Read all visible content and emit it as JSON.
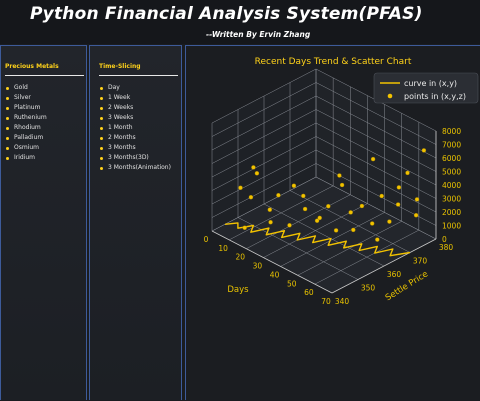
{
  "app": {
    "title": "Python Financial Analysis System(PFAS)",
    "subtitle": "--Written By Ervin Zhang"
  },
  "metals_panel": {
    "title": "Precious Metals",
    "items": [
      "Gold",
      "Silver",
      "Platinum",
      "Ruthenium",
      "Rhodium",
      "Palladium",
      "Osmium",
      "Iridium"
    ]
  },
  "time_panel": {
    "title": "Time-Slicing",
    "items": [
      "Day",
      "1 Week",
      "2 Weeks",
      "3 Weeks",
      "1 Month",
      "2 Months",
      "3 Months",
      "3 Months(3D)",
      "3 Months(Animation)"
    ]
  },
  "colors": {
    "accent": "#ffd21a",
    "series": "#f2c200",
    "panel_border": "#3d5b9a",
    "axis_text": "#e8c200"
  },
  "chart_data": {
    "type": "scatter",
    "title": "Recent Days Trend & Scatter Chart",
    "xlabel": "Days",
    "ylabel": "Settle Price",
    "x_ticks": [
      "0",
      "10",
      "20",
      "30",
      "40",
      "50",
      "60",
      "70"
    ],
    "y_ticks": [
      "340",
      "350",
      "360",
      "370",
      "380"
    ],
    "z_ticks": [
      "0",
      "1000",
      "2000",
      "3000",
      "4000",
      "5000",
      "6000",
      "7000",
      "8000"
    ],
    "xlim": [
      0,
      70
    ],
    "ylim": [
      340,
      380
    ],
    "zlim": [
      0,
      8000
    ],
    "legend": [
      "curve in (x,y)",
      "points in (x,y,z)"
    ],
    "legend_position": "top-right",
    "grid": true,
    "series": [
      {
        "name": "points in (x,y,z)",
        "points": [
          [
            3,
            349,
            2500
          ],
          [
            6,
            351,
            1800
          ],
          [
            8,
            352,
            3600
          ],
          [
            12,
            348,
            4700
          ],
          [
            14,
            353,
            1200
          ],
          [
            16,
            355,
            2200
          ],
          [
            19,
            350,
            900
          ],
          [
            22,
            357,
            3100
          ],
          [
            24,
            354,
            600
          ],
          [
            27,
            358,
            1600
          ],
          [
            29,
            356,
            2900
          ],
          [
            31,
            360,
            800
          ],
          [
            34,
            359,
            1300
          ],
          [
            36,
            361,
            2100
          ],
          [
            39,
            362,
            400
          ],
          [
            41,
            363,
            3800
          ],
          [
            43,
            365,
            1700
          ],
          [
            46,
            364,
            700
          ],
          [
            48,
            366,
            2400
          ],
          [
            51,
            368,
            1100
          ],
          [
            53,
            367,
            6100
          ],
          [
            55,
            369,
            3300
          ],
          [
            58,
            370,
            1500
          ],
          [
            60,
            372,
            2700
          ],
          [
            62,
            371,
            4200
          ],
          [
            64,
            373,
            5200
          ],
          [
            66,
            375,
            2000
          ],
          [
            68,
            374,
            3400
          ],
          [
            69,
            376,
            6900
          ],
          [
            10,
            346,
            300
          ],
          [
            44,
            360,
            5000
          ],
          [
            57,
            366,
            500
          ]
        ]
      },
      {
        "name": "curve in (x,y)",
        "points": [
          [
            0,
            345
          ],
          [
            3,
            348
          ],
          [
            6,
            346
          ],
          [
            9,
            350
          ],
          [
            12,
            347
          ],
          [
            15,
            352
          ],
          [
            18,
            349
          ],
          [
            21,
            354
          ],
          [
            24,
            351
          ],
          [
            27,
            356
          ],
          [
            30,
            353
          ],
          [
            33,
            358
          ],
          [
            36,
            355
          ],
          [
            39,
            360
          ],
          [
            42,
            357
          ],
          [
            45,
            362
          ],
          [
            48,
            359
          ],
          [
            51,
            364
          ],
          [
            54,
            361
          ],
          [
            57,
            366
          ],
          [
            60,
            363
          ],
          [
            63,
            368
          ],
          [
            66,
            365
          ],
          [
            70,
            370
          ]
        ]
      }
    ]
  }
}
